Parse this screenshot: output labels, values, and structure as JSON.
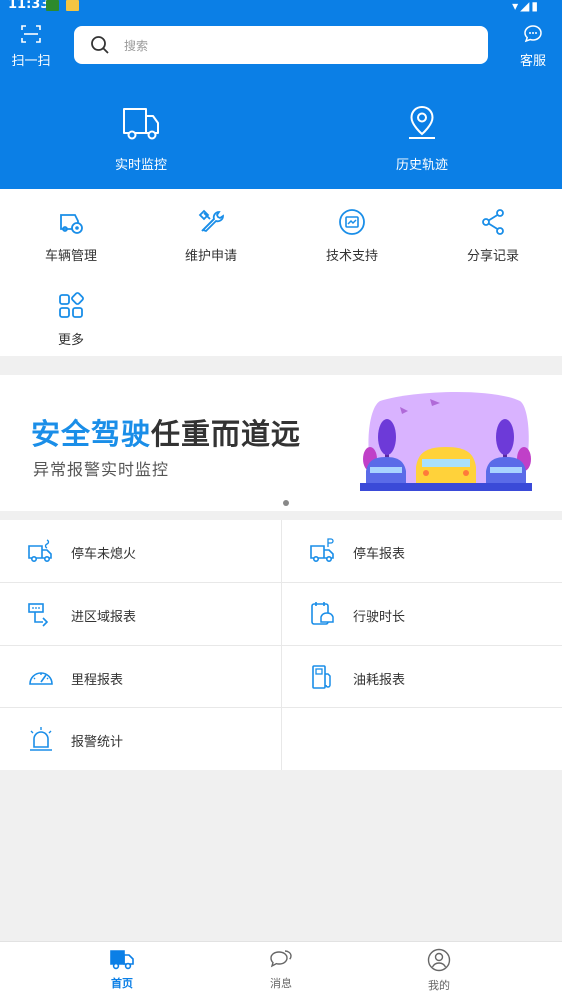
{
  "status": {
    "time": "11:33"
  },
  "header": {
    "scan_label": "扫一扫",
    "search_placeholder": "搜索",
    "service_label": "客服",
    "hero": [
      {
        "label": "实时监控",
        "icon": "truck-icon"
      },
      {
        "label": "历史轨迹",
        "icon": "location-pin-icon"
      }
    ]
  },
  "menu": {
    "items": [
      {
        "label": "车辆管理",
        "icon": "vehicle-settings-icon"
      },
      {
        "label": "维护申请",
        "icon": "tools-icon"
      },
      {
        "label": "技术支持",
        "icon": "support-icon"
      },
      {
        "label": "分享记录",
        "icon": "share-icon"
      },
      {
        "label": "更多",
        "icon": "more-grid-icon"
      }
    ]
  },
  "banner": {
    "title_blue": "安全驾驶",
    "title_dark": "任重而道远",
    "subtitle": "异常报警实时监控",
    "colors": {
      "accent": "#1a8ee8",
      "art_bg": "#d9b3ff"
    }
  },
  "reports": {
    "items": [
      {
        "label": "停车未熄火",
        "icon": "truck-engine-icon"
      },
      {
        "label": "停车报表",
        "icon": "truck-parking-icon"
      },
      {
        "label": "进区域报表",
        "icon": "area-entry-icon"
      },
      {
        "label": "行驶时长",
        "icon": "driving-duration-icon"
      },
      {
        "label": "里程报表",
        "icon": "odometer-icon"
      },
      {
        "label": "油耗报表",
        "icon": "fuel-pump-icon"
      },
      {
        "label": "报警统计",
        "icon": "alarm-light-icon"
      }
    ]
  },
  "tabbar": {
    "home": "首页",
    "messages": "消息",
    "mine": "我的",
    "active": "home",
    "colors": {
      "active": "#0b7fe6",
      "inactive": "#666666"
    }
  },
  "theme": {
    "primary": "#0b7fe6",
    "icon_blue": "#1a8ee8"
  }
}
